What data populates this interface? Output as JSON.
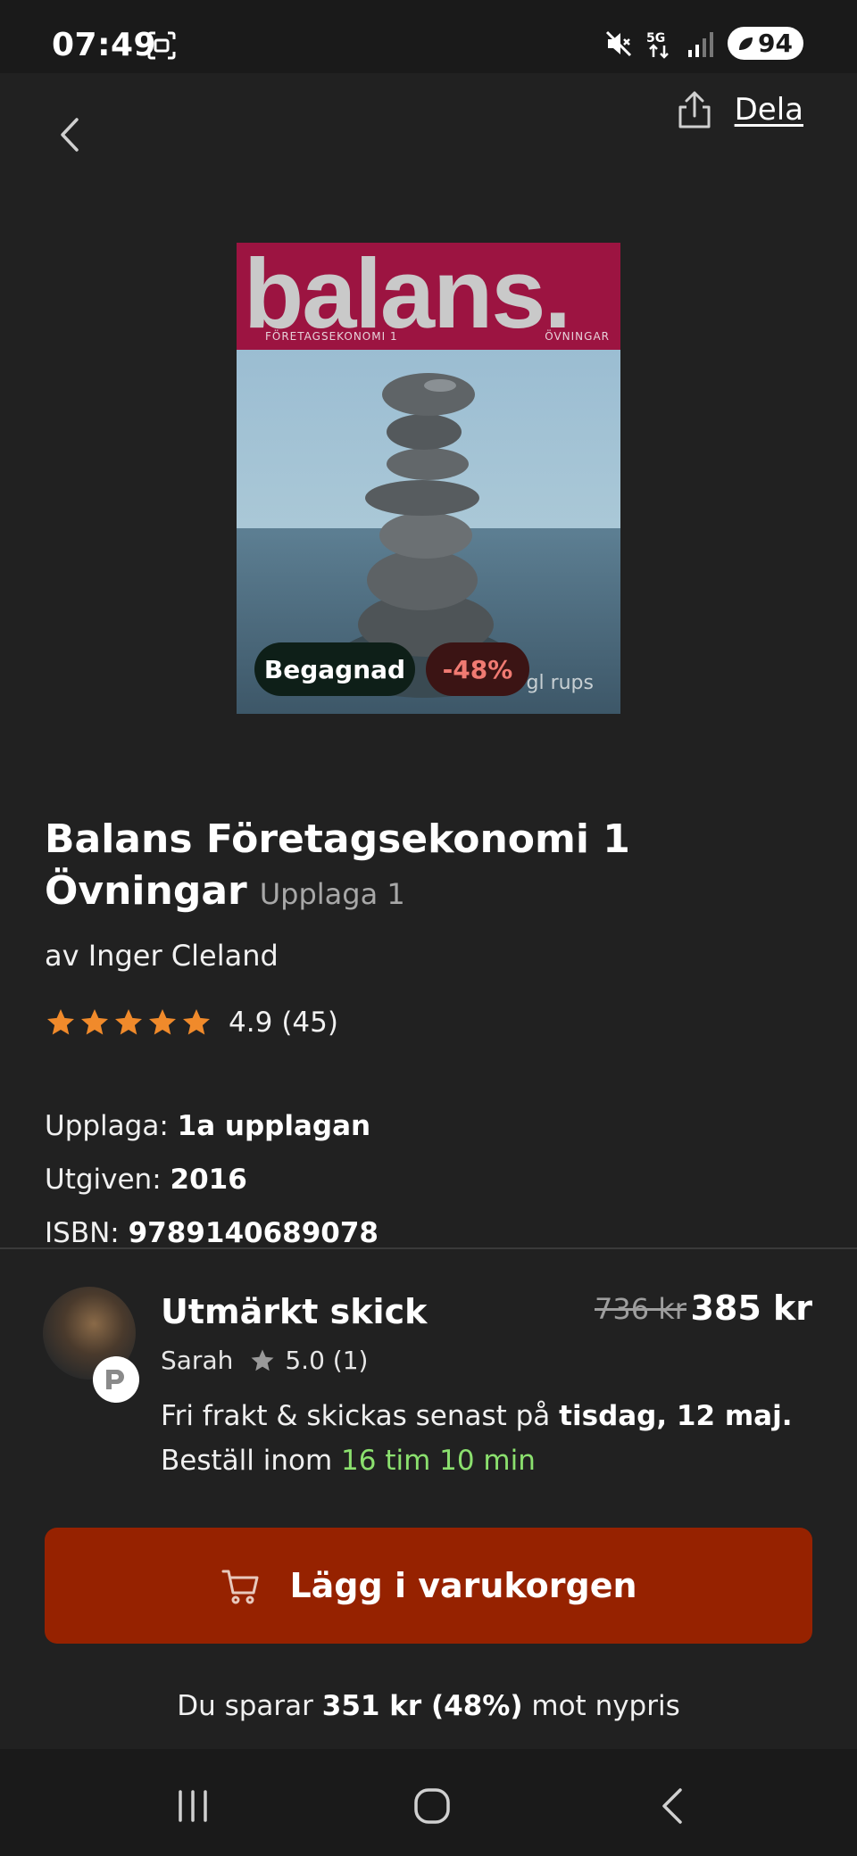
{
  "status_bar": {
    "time": "07:49",
    "network": "5G",
    "battery": "94",
    "icons": [
      "screenshot-icon",
      "mute-icon",
      "5g-icon",
      "signal-icon",
      "battery-icon"
    ]
  },
  "nav": {
    "back_icon": "chevron-left-icon",
    "share_icon": "share-icon",
    "share_label": "Dela"
  },
  "cover": {
    "title": "balans.",
    "subtitle_left": "FÖRETAGSEKONOMI 1",
    "subtitle_right": "ÖVNINGAR",
    "publisher": "gl  rups",
    "colors": {
      "band": "#9c1441",
      "title_text": "#c9c9c9"
    }
  },
  "badges": {
    "condition": "Begagnad",
    "discount": "-48%"
  },
  "product": {
    "title": "Balans Företagsekonomi 1 Övningar",
    "edition_inline": "Upplaga 1",
    "author": "av Inger Cleland",
    "rating_value": "4.9",
    "rating_count": "(45)",
    "stars": 5,
    "star_color": "#f08a2b"
  },
  "specs": {
    "edition_label": "Upplaga:",
    "edition_value": "1a upplagan",
    "published_label": "Utgiven:",
    "published_value": "2016",
    "isbn_label": "ISBN:",
    "isbn_value": "9789140689078"
  },
  "offer": {
    "condition": "Utmärkt skick",
    "seller_name": "Sarah",
    "seller_rating": "5.0 (1)",
    "price_old": "736 kr",
    "price_new": "385 kr",
    "shipping_text": "Fri frakt & skickas senast på",
    "shipping_date": "tisdag, 12 maj.",
    "order_text": "Beställ inom",
    "order_time": "16 tim 10 min",
    "accent_green": "#8be06e"
  },
  "cart_button": {
    "label": "Lägg i varukorgen",
    "icon": "cart-icon",
    "color": "#962200"
  },
  "savings": {
    "prefix": "Du sparar",
    "amount": "351 kr (48%)",
    "suffix": "mot nypris"
  },
  "system_nav": {
    "icons": [
      "recent-apps-icon",
      "home-icon",
      "system-back-icon"
    ]
  }
}
